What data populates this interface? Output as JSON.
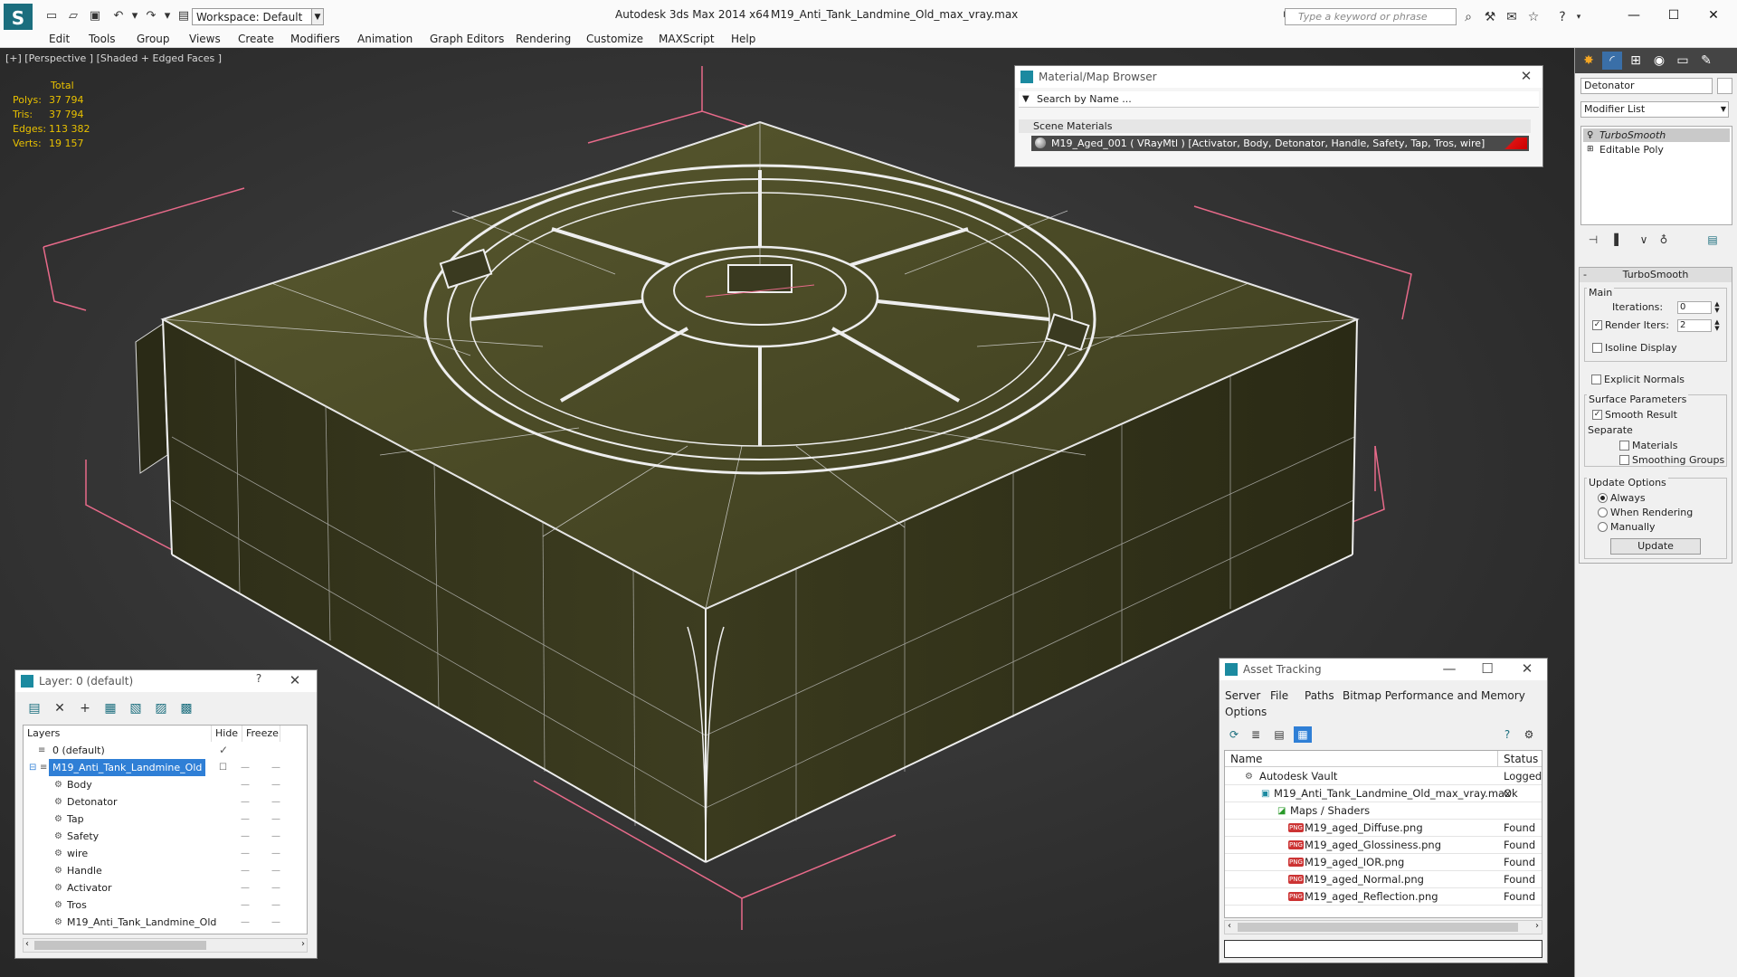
{
  "app": {
    "title": "Autodesk 3ds Max  2014 x64",
    "file": "M19_Anti_Tank_Landmine_Old_max_vray.max",
    "workspace": "Workspace: Default",
    "search_placeholder": "Type a keyword or phrase"
  },
  "menu": [
    "Edit",
    "Tools",
    "Group",
    "Views",
    "Create",
    "Modifiers",
    "Animation",
    "Graph Editors",
    "Rendering",
    "Customize",
    "MAXScript",
    "Help"
  ],
  "viewport": {
    "label": "[+] [Perspective ] [Shaded + Edged Faces ]",
    "stats_header": "Total",
    "stats": [
      {
        "k": "Polys:",
        "v": "37 794"
      },
      {
        "k": "Tris:",
        "v": "37 794"
      },
      {
        "k": "Edges:",
        "v": "113 382"
      },
      {
        "k": "Verts:",
        "v": "19 157"
      }
    ]
  },
  "command_panel": {
    "object_name": "Detonator",
    "modifier_list": "Modifier List",
    "stack": [
      "TurboSmooth",
      "Editable Poly"
    ],
    "rollout": "TurboSmooth",
    "main_label": "Main",
    "iterations_label": "Iterations:",
    "iterations": "0",
    "render_iters_label": "Render Iters:",
    "render_iters": "2",
    "isoline": "Isoline Display",
    "explicit_normals": "Explicit Normals",
    "surface_params": "Surface Parameters",
    "smooth_result": "Smooth Result",
    "separate": "Separate",
    "materials": "Materials",
    "smoothing_groups": "Smoothing Groups",
    "update_options": "Update Options",
    "always": "Always",
    "when_rendering": "When Rendering",
    "manually": "Manually",
    "update_btn": "Update"
  },
  "material_browser": {
    "title": "Material/Map Browser",
    "search": "Search by Name ...",
    "section": "Scene Materials",
    "material": "M19_Aged_001  ( VRayMtl )  [Activator, Body, Detonator, Handle, Safety, Tap, Tros, wire]"
  },
  "layers": {
    "title": "Layer: 0 (default)",
    "help": "?",
    "col_layers": "Layers",
    "col_hide": "Hide",
    "col_freeze": "Freeze",
    "rows": [
      {
        "name": "0 (default)",
        "indent": 1
      },
      {
        "name": "M19_Anti_Tank_Landmine_Old",
        "indent": 1,
        "selected": true
      },
      {
        "name": "Body",
        "indent": 2
      },
      {
        "name": "Detonator",
        "indent": 2
      },
      {
        "name": "Tap",
        "indent": 2
      },
      {
        "name": "Safety",
        "indent": 2
      },
      {
        "name": "wire",
        "indent": 2
      },
      {
        "name": "Handle",
        "indent": 2
      },
      {
        "name": "Activator",
        "indent": 2
      },
      {
        "name": "Tros",
        "indent": 2
      },
      {
        "name": "M19_Anti_Tank_Landmine_Old",
        "indent": 2
      }
    ]
  },
  "asset_tracking": {
    "title": "Asset Tracking",
    "menu": [
      "Server",
      "File",
      "Paths",
      "Bitmap Performance and Memory",
      "Options"
    ],
    "col_name": "Name",
    "col_status": "Status",
    "rows": [
      {
        "name": "Autodesk Vault",
        "status": "Logged",
        "indent": 1,
        "icon": "vault"
      },
      {
        "name": "M19_Anti_Tank_Landmine_Old_max_vray.max",
        "status": "Ok",
        "indent": 2,
        "icon": "max"
      },
      {
        "name": "Maps / Shaders",
        "status": "",
        "indent": 3,
        "icon": "maps"
      },
      {
        "name": "M19_aged_Diffuse.png",
        "status": "Found",
        "indent": 4,
        "icon": "png"
      },
      {
        "name": "M19_aged_Glossiness.png",
        "status": "Found",
        "indent": 4,
        "icon": "png"
      },
      {
        "name": "M19_aged_IOR.png",
        "status": "Found",
        "indent": 4,
        "icon": "png"
      },
      {
        "name": "M19_aged_Normal.png",
        "status": "Found",
        "indent": 4,
        "icon": "png"
      },
      {
        "name": "M19_aged_Reflection.png",
        "status": "Found",
        "indent": 4,
        "icon": "png"
      }
    ]
  },
  "colors": {
    "accent": "#2f7fd6",
    "stats": "#e8c000",
    "selection_box": "#e86a8a",
    "brand": "#1b6e7e"
  }
}
